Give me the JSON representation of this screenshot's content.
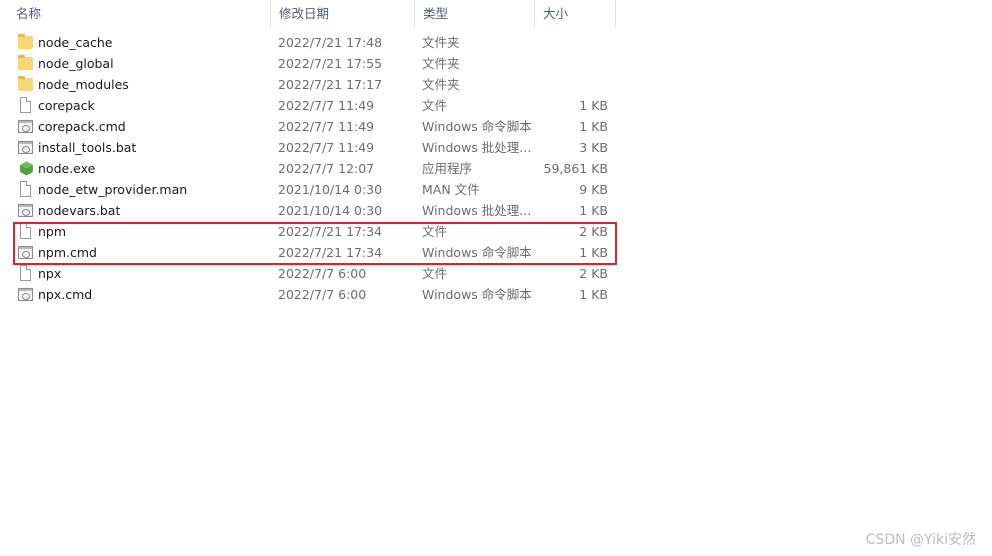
{
  "header": {
    "name": "名称",
    "date": "修改日期",
    "type": "类型",
    "size": "大小"
  },
  "files": [
    {
      "name": "node_cache",
      "date": "2022/7/21 17:48",
      "type": "文件夹",
      "size": "",
      "icon": "folder-icon"
    },
    {
      "name": "node_global",
      "date": "2022/7/21 17:55",
      "type": "文件夹",
      "size": "",
      "icon": "folder-icon"
    },
    {
      "name": "node_modules",
      "date": "2022/7/21 17:17",
      "type": "文件夹",
      "size": "",
      "icon": "folder-icon"
    },
    {
      "name": "corepack",
      "date": "2022/7/7 11:49",
      "type": "文件",
      "size": "1 KB",
      "icon": "file-icon"
    },
    {
      "name": "corepack.cmd",
      "date": "2022/7/7 11:49",
      "type": "Windows 命令脚本",
      "size": "1 KB",
      "icon": "cmd-script-icon"
    },
    {
      "name": "install_tools.bat",
      "date": "2022/7/7 11:49",
      "type": "Windows 批处理...",
      "size": "3 KB",
      "icon": "batch-file-icon"
    },
    {
      "name": "node.exe",
      "date": "2022/7/7 12:07",
      "type": "应用程序",
      "size": "59,861 KB",
      "icon": "nodejs-icon"
    },
    {
      "name": "node_etw_provider.man",
      "date": "2021/10/14 0:30",
      "type": "MAN 文件",
      "size": "9 KB",
      "icon": "file-icon"
    },
    {
      "name": "nodevars.bat",
      "date": "2021/10/14 0:30",
      "type": "Windows 批处理...",
      "size": "1 KB",
      "icon": "batch-file-icon"
    },
    {
      "name": "npm",
      "date": "2022/7/21 17:34",
      "type": "文件",
      "size": "2 KB",
      "icon": "file-icon"
    },
    {
      "name": "npm.cmd",
      "date": "2022/7/21 17:34",
      "type": "Windows 命令脚本",
      "size": "1 KB",
      "icon": "cmd-script-icon"
    },
    {
      "name": "npx",
      "date": "2022/7/7 6:00",
      "type": "文件",
      "size": "2 KB",
      "icon": "file-icon"
    },
    {
      "name": "npx.cmd",
      "date": "2022/7/7 6:00",
      "type": "Windows 命令脚本",
      "size": "1 KB",
      "icon": "cmd-script-icon"
    }
  ],
  "watermark": "CSDN @Yiki安然",
  "colors": {
    "highlight": "#d9232d",
    "folder": "#f8d775",
    "node_green": "#539e43"
  }
}
